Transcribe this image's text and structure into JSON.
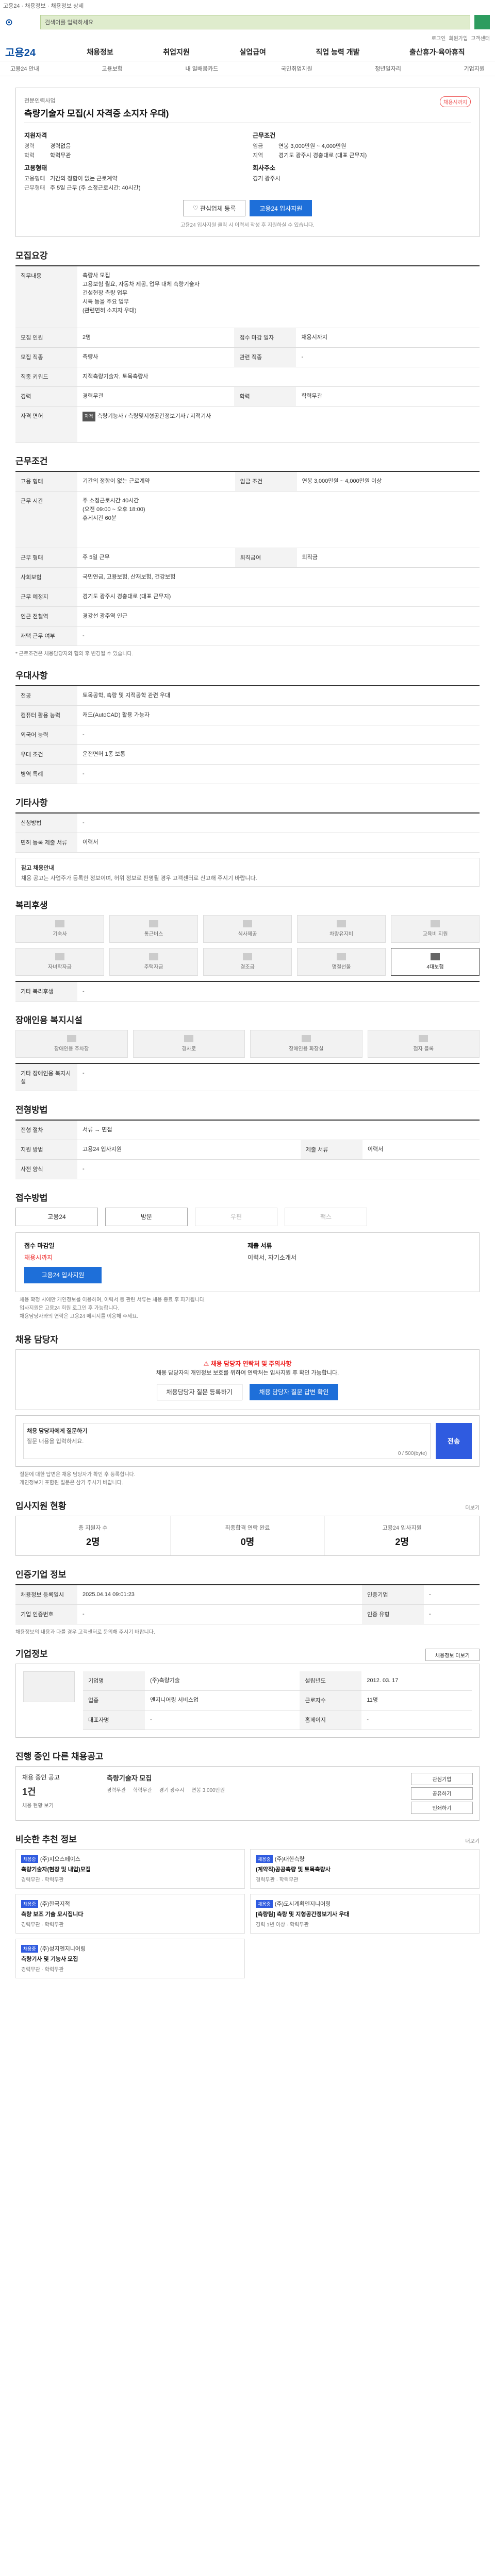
{
  "top": {
    "breadcrumb": "고용24 · 채용정보 · 채용정보 상세"
  },
  "search": {
    "placeholder": "검색어를 입력하세요"
  },
  "util": [
    "로그인",
    "회원가입",
    "고객센터"
  ],
  "gnb": {
    "brand": "고용24",
    "menu": [
      "채용정보",
      "취업지원",
      "실업급여",
      "직업 능력 개발",
      "출산휴가·육아휴직"
    ]
  },
  "lnb": [
    "고용24 안내",
    "고용보험",
    "내 일배움카드",
    "국민취업지원",
    "청년일자리",
    "기업지원"
  ],
  "header": {
    "company_label": "전문인력사업",
    "title": "측량기술자 모집(시 자격증 소지자 우대)",
    "badge": "채용시까지",
    "left_head": "지원자격",
    "right_head": "근무조건",
    "left": [
      {
        "k": "경력",
        "v": "경력없음"
      },
      {
        "k": "학력",
        "v": "학력무관"
      }
    ],
    "right": [
      {
        "k": "임금",
        "v": "연봉 3,000만원 ~ 4,000만원"
      },
      {
        "k": "지역",
        "v": "경기도 광주시 경충대로 (대표 근무지)"
      }
    ],
    "left2_head": "고용형태",
    "left2": [
      {
        "k": "고용형태",
        "v": "기간의 정함이 없는 근로계약"
      },
      {
        "k": "근무형태",
        "v": "주 5일 근무 (주 소정근로시간: 40시간)"
      }
    ],
    "right2_head": "회사주소",
    "right2": [
      {
        "k": "",
        "v": "경기 광주시"
      }
    ],
    "btn_interest": "관심업체 등록",
    "btn_apply": "고용24 입사지원",
    "note": "고용24 입사지원 클릭 시 이력서 작성 후 지원하실 수 있습니다."
  },
  "recruit": {
    "title": "모집요강",
    "rows": [
      {
        "k": "직무내용",
        "v": "측량사 모집\n고용보험 월요, 자동차 제공, 업무 대체 측량기술자\n건설현장 측량 업무\n시특 등을 주요 업무\n(관련면허 소지자 우대)"
      },
      {
        "k": "모집 인원",
        "v": "2명"
      },
      {
        "k": "접수 마감 일자",
        "v": "채용시까지"
      },
      {
        "k": "모집 직종",
        "v": "측량사"
      },
      {
        "k": "관련 직종",
        "v": "-"
      },
      {
        "k": "직종 키워드",
        "v": "지적측량기술자, 토목측량사"
      },
      {
        "k": "경력",
        "v": "경력무관"
      },
      {
        "k": "학력",
        "v": "학력무관"
      },
      {
        "k": "자격 면허",
        "v": "측량기능사 / 측량및지형공간정보기사 / 지적기사"
      }
    ]
  },
  "cond": {
    "title": "근무조건",
    "rows": [
      {
        "k": "고용 형태",
        "v": "기간의 정함이 없는 근로계약"
      },
      {
        "k": "임금 조건",
        "v": "연봉 3,000만원 ~ 4,000만원 이상"
      },
      {
        "k": "근무 시간",
        "v": "주 소정근로시간 40시간\n(오전 09:00 ~ 오후 18:00)\n휴게시간 60분"
      },
      {
        "k": "근무 형태",
        "v": "주 5일 근무"
      },
      {
        "k": "퇴직급여",
        "v": "퇴직금"
      },
      {
        "k": "사회보험",
        "v": "국민연금, 고용보험, 산재보험, 건강보험"
      },
      {
        "k": "근무 예정지",
        "v": "경기도 광주시 경충대로 (대표 근무지)"
      },
      {
        "k": "인근 전철역",
        "v": "경강선 광주역 인근"
      },
      {
        "k": "재택 근무 여부",
        "v": "-"
      }
    ],
    "note": "* 근로조건은 채용담당자와 협의 후 변경될 수 있습니다."
  },
  "prefer": {
    "title": "우대사항",
    "rows": [
      {
        "k": "전공",
        "v": "토목공학, 측량 및 지적공학 관련 우대"
      },
      {
        "k": "컴퓨터 활용 능력",
        "v": "캐드(AutoCAD) 활용 가능자"
      },
      {
        "k": "외국어 능력",
        "v": "-"
      },
      {
        "k": "우대 조건",
        "v": "운전면허 1종 보통"
      },
      {
        "k": "병역 특례",
        "v": "-"
      }
    ]
  },
  "etc": {
    "title": "기타사항",
    "rows": [
      {
        "k": "신청방법",
        "v": "-"
      },
      {
        "k": "면허 등록 제출 서류",
        "v": "이력서"
      }
    ],
    "notice_title": "참고 채용안내",
    "notice": "채용 공고는 사업주가 등록한 정보이며, 허위 정보로 판명될 경우 고객센터로 신고해 주시기 바랍니다."
  },
  "welfare": {
    "title": "복리후생",
    "items": [
      "기숙사",
      "통근버스",
      "식사제공",
      "차량유지비",
      "교육비 지원",
      "자녀학자금",
      "주택자금",
      "경조금",
      "명절선물",
      "4대보험"
    ],
    "extra_label": "기타 복리후생",
    "extra_value": "-"
  },
  "disabled": {
    "title": "장애인용 복지시설",
    "items": [
      "장애인용 주차장",
      "경사로",
      "장애인용 화장실",
      "점자 블록"
    ],
    "extra_label": "기타 장애인용 복지시설",
    "extra_value": "-"
  },
  "procedure": {
    "title": "전형방법",
    "rows": [
      {
        "k": "전형 절차",
        "v": "서류 → 면접"
      },
      {
        "k": "지원 방법",
        "v": "고용24 입사지원"
      },
      {
        "k": "제출 서류",
        "v": "이력서"
      },
      {
        "k": "사전 양식",
        "v": "-"
      }
    ]
  },
  "method": {
    "title": "접수방법",
    "buttons": [
      "고용24",
      "방문",
      "우편",
      "팩스"
    ],
    "left_head": "접수 마감일",
    "left_value": "채용시까지",
    "right_head": "제출 서류",
    "right_value": "이력서, 자기소개서",
    "apply": "고용24 입사지원",
    "bullets": [
      "채용 확정 시에만 개인정보를 이용하며, 이력서 등 관련 서류는 채용 종료 후 파기됩니다.",
      "입사지원은 고용24 회원 로그인 후 가능합니다.",
      "채용담당자와의 연락은 고용24 메시지를 이용해 주세요."
    ]
  },
  "contact": {
    "title": "채용 담당자",
    "warn_title": "채용 담당자 연락처 및 주의사항",
    "warn_body": "채용 담당자의 개인정보 보호를 위하여 연락처는 입사지원 후 확인 가능합니다.",
    "btn_left": "채용담당자 질문 등록하기",
    "btn_right": "채용 담당자 질문 답변 확인",
    "q_label": "채용 담당자에게 질문하기",
    "q_placeholder": "질문 내용을 입력하세요.",
    "q_count": "0 / 500(byte)",
    "send": "전송",
    "bullets": [
      "질문에 대한 답변은 채용 담당자가 확인 후 등록합니다.",
      "개인정보가 포함된 질문은 삼가 주시기 바랍니다."
    ]
  },
  "stats": {
    "title": "입사지원 현황",
    "more": "더보기",
    "items": [
      {
        "label": "총 지원자 수",
        "value": "2명"
      },
      {
        "label": "최종합격 연락 완료",
        "value": "0명"
      },
      {
        "label": "고용24 입사지원",
        "value": "2명"
      }
    ]
  },
  "status": {
    "title": "인증기업 정보",
    "rows": [
      {
        "k": "채용정보 등록일시",
        "v": "2025.04.14 09:01:23"
      },
      {
        "k": "인증기업",
        "v": "-"
      },
      {
        "k": "기업 인증번호",
        "v": "-"
      },
      {
        "k": "인증 유형",
        "v": "-"
      }
    ],
    "note": "채용정보의 내용과 다를 경우 고객센터로 문의해 주시기 바랍니다."
  },
  "company": {
    "title": "기업정보",
    "more": "채용정보 더보기",
    "rows": [
      {
        "k": "기업명",
        "v": "(주)측량기술"
      },
      {
        "k": "업종",
        "v": "엔지니어링 서비스업"
      },
      {
        "k": "대표자명",
        "v": "-"
      },
      {
        "k": "근로자수",
        "v": "11명"
      },
      {
        "k": "설립년도",
        "v": "2012. 03. 17"
      },
      {
        "k": "홈페이지",
        "v": "-"
      }
    ]
  },
  "ongoing": {
    "title": "진행 중인 다른 채용공고",
    "left_title": "채용 중인 공고",
    "left_count": "1건",
    "left_sub": "채용 현황 보기",
    "right": {
      "name": "측량기술자 모집",
      "items": [
        "경력무관",
        "학력무관",
        "경기 광주시",
        "연봉 3,000만원"
      ]
    },
    "side": [
      "관심기업",
      "공유하기",
      "인쇄하기"
    ]
  },
  "similar": {
    "title": "비슷한 추천 정보",
    "more": "더보기",
    "cards": [
      {
        "label": "채용중",
        "company": "(주)지오스페이스",
        "title": "측량기술자(현장 및 내업)모집",
        "meta": "경력무관 · 학력무관"
      },
      {
        "label": "채용중",
        "company": "(주)대한측량",
        "title": "(계약직)공공측량 및 토목측량사",
        "meta": "경력무관 · 학력무관"
      },
      {
        "label": "채용중",
        "company": "(주)한국지적",
        "title": "측량 보조 기술 모시집니다",
        "meta": "경력무관 · 학력무관"
      },
      {
        "label": "채용중",
        "company": "(주)도시계획엔지니어링",
        "title": "[측량팀] 측량 및 지형공간정보기사 우대",
        "meta": "경력 1년 이상 · 학력무관"
      },
      {
        "label": "채용중",
        "company": "(주)성지엔지니어링",
        "title": "측량기사 및 기능사 모집",
        "meta": "경력무관 · 학력무관"
      }
    ]
  }
}
